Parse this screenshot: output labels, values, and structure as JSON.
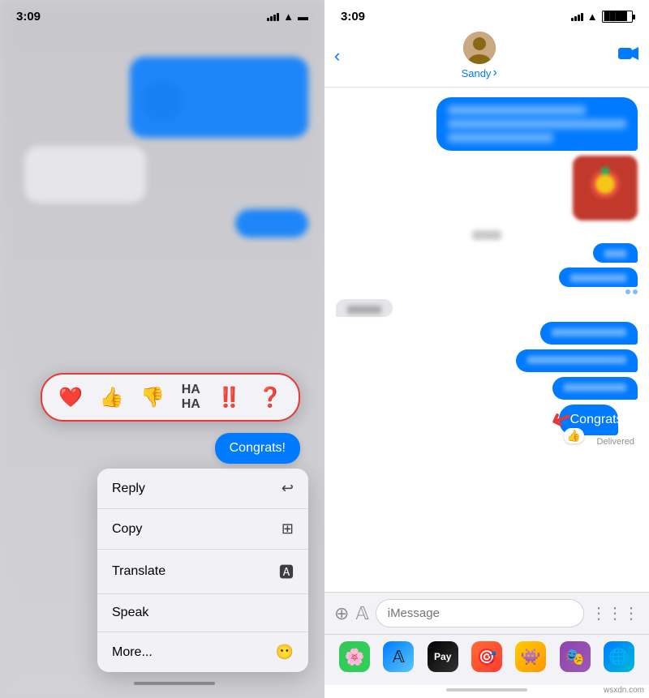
{
  "left_panel": {
    "time": "3:09",
    "reaction_bar": {
      "emojis": [
        "❤️",
        "👍",
        "👎",
        "😂",
        "‼️",
        "❓"
      ]
    },
    "congrats_bubble": "Congrats!",
    "context_menu": {
      "items": [
        {
          "label": "Reply",
          "icon": "↩"
        },
        {
          "label": "Copy",
          "icon": "📋"
        },
        {
          "label": "Translate",
          "icon": "🅰"
        },
        {
          "label": "Speak",
          "icon": ""
        },
        {
          "label": "More...",
          "icon": "😶"
        }
      ]
    }
  },
  "right_panel": {
    "time": "3:09",
    "contact_name": "Sandy",
    "chevron": "›",
    "input_placeholder": "iMessage",
    "delivered_label": "Delivered",
    "congrats_text": "Congrats!",
    "dock_apps": [
      "📷",
      "📱",
      "💳",
      "🎯",
      "🎮",
      "🎭",
      "🌐"
    ]
  },
  "watermark": "wsxdn.com"
}
